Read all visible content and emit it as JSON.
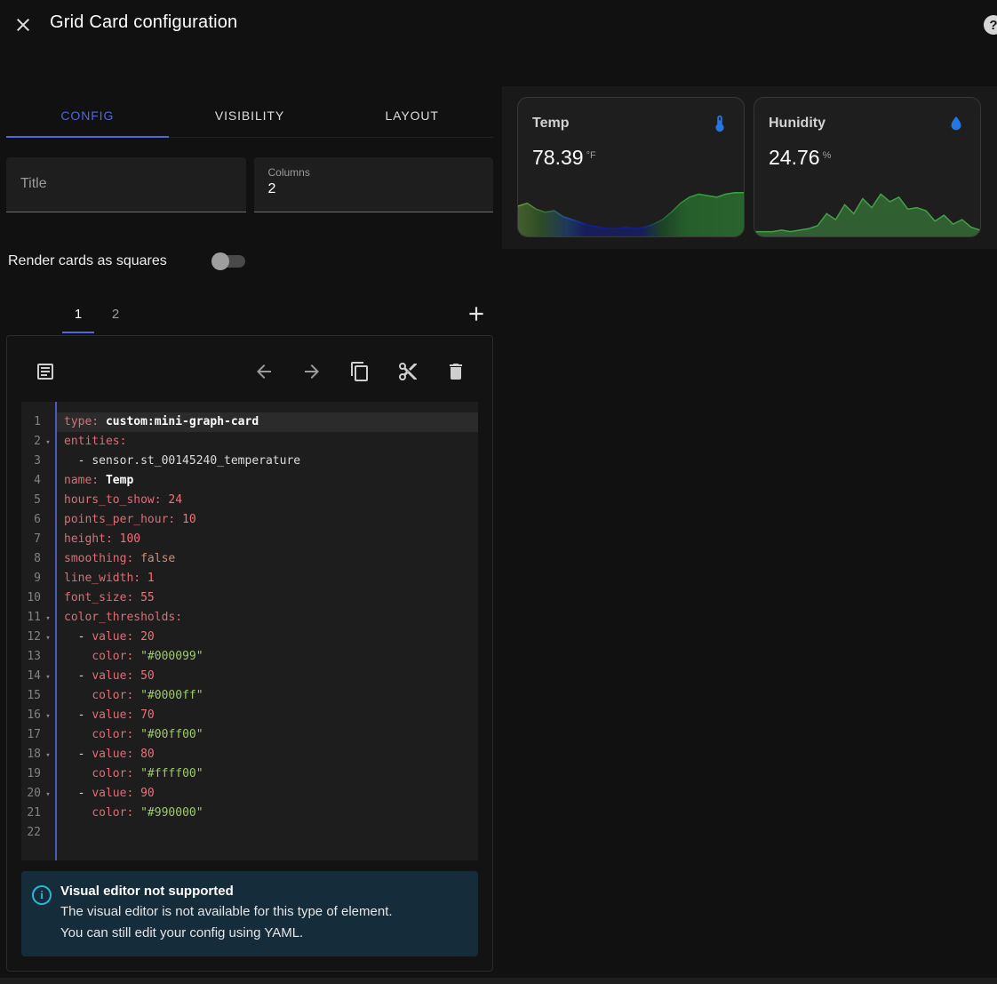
{
  "colors": {
    "accent": "#5266d8",
    "info_accent": "#2bb8d8"
  },
  "header": {
    "title": "Grid Card configuration",
    "close_icon": "close-icon",
    "help_icon": "help-icon",
    "help_glyph": "?"
  },
  "tabs": {
    "items": [
      {
        "label": "CONFIG"
      },
      {
        "label": "VISIBILITY"
      },
      {
        "label": "LAYOUT"
      }
    ],
    "active_index": 0
  },
  "form": {
    "title_field": {
      "label": "Title",
      "value": ""
    },
    "columns_field": {
      "label": "Columns",
      "value": "2"
    },
    "squares_toggle": {
      "label": "Render cards as squares",
      "state": "off"
    }
  },
  "card_selector": {
    "tabs": [
      "1",
      "2"
    ],
    "active_index": 0,
    "add_icon": "plus-icon"
  },
  "toolbar": {
    "icons": [
      "list-box-icon",
      "undo-icon",
      "redo-icon",
      "copy-icon",
      "cut-icon",
      "delete-icon"
    ]
  },
  "editor": {
    "token_colors": {
      "key": "#e06c75",
      "num": "#f07178",
      "atom": "#cf8e6d",
      "str": "#9ccc65",
      "plain": "#dcdcdc",
      "bold": "#ffffff"
    },
    "active_line": 1,
    "lines": [
      {
        "n": "1",
        "fold": false,
        "tokens": [
          [
            "type:",
            "key"
          ],
          [
            " ",
            "plain"
          ],
          [
            "custom:mini-graph-card",
            "bold"
          ]
        ]
      },
      {
        "n": "2",
        "fold": true,
        "tokens": [
          [
            "entities:",
            "key"
          ]
        ]
      },
      {
        "n": "3",
        "fold": false,
        "tokens": [
          [
            "  - ",
            "plain"
          ],
          [
            "sensor.st_00145240_temperature",
            "plain"
          ]
        ]
      },
      {
        "n": "4",
        "fold": false,
        "tokens": [
          [
            "name:",
            "key"
          ],
          [
            " ",
            "plain"
          ],
          [
            "Temp",
            "bold"
          ]
        ]
      },
      {
        "n": "5",
        "fold": false,
        "tokens": [
          [
            "hours_to_show:",
            "key"
          ],
          [
            " ",
            "plain"
          ],
          [
            "24",
            "num"
          ]
        ]
      },
      {
        "n": "6",
        "fold": false,
        "tokens": [
          [
            "points_per_hour:",
            "key"
          ],
          [
            " ",
            "plain"
          ],
          [
            "10",
            "num"
          ]
        ]
      },
      {
        "n": "7",
        "fold": false,
        "tokens": [
          [
            "height:",
            "key"
          ],
          [
            " ",
            "plain"
          ],
          [
            "100",
            "num"
          ]
        ]
      },
      {
        "n": "8",
        "fold": false,
        "tokens": [
          [
            "smoothing:",
            "key"
          ],
          [
            " ",
            "plain"
          ],
          [
            "false",
            "atom"
          ]
        ]
      },
      {
        "n": "9",
        "fold": false,
        "tokens": [
          [
            "line_width:",
            "key"
          ],
          [
            " ",
            "plain"
          ],
          [
            "1",
            "num"
          ]
        ]
      },
      {
        "n": "10",
        "fold": false,
        "tokens": [
          [
            "font_size:",
            "key"
          ],
          [
            " ",
            "plain"
          ],
          [
            "55",
            "num"
          ]
        ]
      },
      {
        "n": "11",
        "fold": true,
        "tokens": [
          [
            "color_thresholds:",
            "key"
          ]
        ]
      },
      {
        "n": "12",
        "fold": true,
        "tokens": [
          [
            "  - ",
            "plain"
          ],
          [
            "value:",
            "key"
          ],
          [
            " ",
            "plain"
          ],
          [
            "20",
            "num"
          ]
        ]
      },
      {
        "n": "13",
        "fold": false,
        "tokens": [
          [
            "    ",
            "plain"
          ],
          [
            "color:",
            "key"
          ],
          [
            " ",
            "plain"
          ],
          [
            "\"#000099\"",
            "str"
          ]
        ]
      },
      {
        "n": "14",
        "fold": true,
        "tokens": [
          [
            "  - ",
            "plain"
          ],
          [
            "value:",
            "key"
          ],
          [
            " ",
            "plain"
          ],
          [
            "50",
            "num"
          ]
        ]
      },
      {
        "n": "15",
        "fold": false,
        "tokens": [
          [
            "    ",
            "plain"
          ],
          [
            "color:",
            "key"
          ],
          [
            " ",
            "plain"
          ],
          [
            "\"#0000ff\"",
            "str"
          ]
        ]
      },
      {
        "n": "16",
        "fold": true,
        "tokens": [
          [
            "  - ",
            "plain"
          ],
          [
            "value:",
            "key"
          ],
          [
            " ",
            "plain"
          ],
          [
            "70",
            "num"
          ]
        ]
      },
      {
        "n": "17",
        "fold": false,
        "tokens": [
          [
            "    ",
            "plain"
          ],
          [
            "color:",
            "key"
          ],
          [
            " ",
            "plain"
          ],
          [
            "\"#00ff00\"",
            "str"
          ]
        ]
      },
      {
        "n": "18",
        "fold": true,
        "tokens": [
          [
            "  - ",
            "plain"
          ],
          [
            "value:",
            "key"
          ],
          [
            " ",
            "plain"
          ],
          [
            "80",
            "num"
          ]
        ]
      },
      {
        "n": "19",
        "fold": false,
        "tokens": [
          [
            "    ",
            "plain"
          ],
          [
            "color:",
            "key"
          ],
          [
            " ",
            "plain"
          ],
          [
            "\"#ffff00\"",
            "str"
          ]
        ]
      },
      {
        "n": "20",
        "fold": true,
        "tokens": [
          [
            "  - ",
            "plain"
          ],
          [
            "value:",
            "key"
          ],
          [
            " ",
            "plain"
          ],
          [
            "90",
            "num"
          ]
        ]
      },
      {
        "n": "21",
        "fold": false,
        "tokens": [
          [
            "    ",
            "plain"
          ],
          [
            "color:",
            "key"
          ],
          [
            " ",
            "plain"
          ],
          [
            "\"#990000\"",
            "str"
          ]
        ]
      },
      {
        "n": "22",
        "fold": false,
        "tokens": []
      }
    ]
  },
  "info_box": {
    "title": "Visual editor not supported",
    "body": [
      "The visual editor is not available for this type of element.",
      "You can still edit your config using YAML."
    ]
  },
  "preview": {
    "cards": [
      {
        "name": "Temp",
        "icon": "thermometer-icon",
        "icon_color": "#2377e4",
        "value": "78.39",
        "unit": "°F",
        "graph": {
          "max": 32,
          "points": [
            19,
            21,
            17,
            15,
            16,
            12,
            10,
            8,
            6,
            5,
            4,
            4,
            5,
            4,
            5,
            7,
            10,
            15,
            21,
            25,
            27,
            26,
            25,
            27,
            28,
            28
          ],
          "stops": [
            [
              "0%",
              "#6a9f3c"
            ],
            [
              "10%",
              "#3e7a2e"
            ],
            [
              "22%",
              "#20509a"
            ],
            [
              "30%",
              "#101e96"
            ],
            [
              "55%",
              "#101e96"
            ],
            [
              "64%",
              "#1d6a2c"
            ],
            [
              "75%",
              "#2f9e3a"
            ],
            [
              "100%",
              "#35a83c"
            ]
          ]
        }
      },
      {
        "name": "Hunidity",
        "icon": "water-drop-icon",
        "icon_color": "#2377e4",
        "value": "24.76",
        "unit": "%",
        "graph": {
          "max": 32,
          "points": [
            2,
            2,
            2,
            3,
            2,
            3,
            4,
            6,
            14,
            10,
            20,
            14,
            24,
            18,
            27,
            22,
            25,
            17,
            18,
            16,
            9,
            13,
            7,
            10,
            5,
            3
          ],
          "stops": [
            [
              "0%",
              "#43a047"
            ],
            [
              "100%",
              "#43a047"
            ]
          ]
        }
      }
    ]
  }
}
